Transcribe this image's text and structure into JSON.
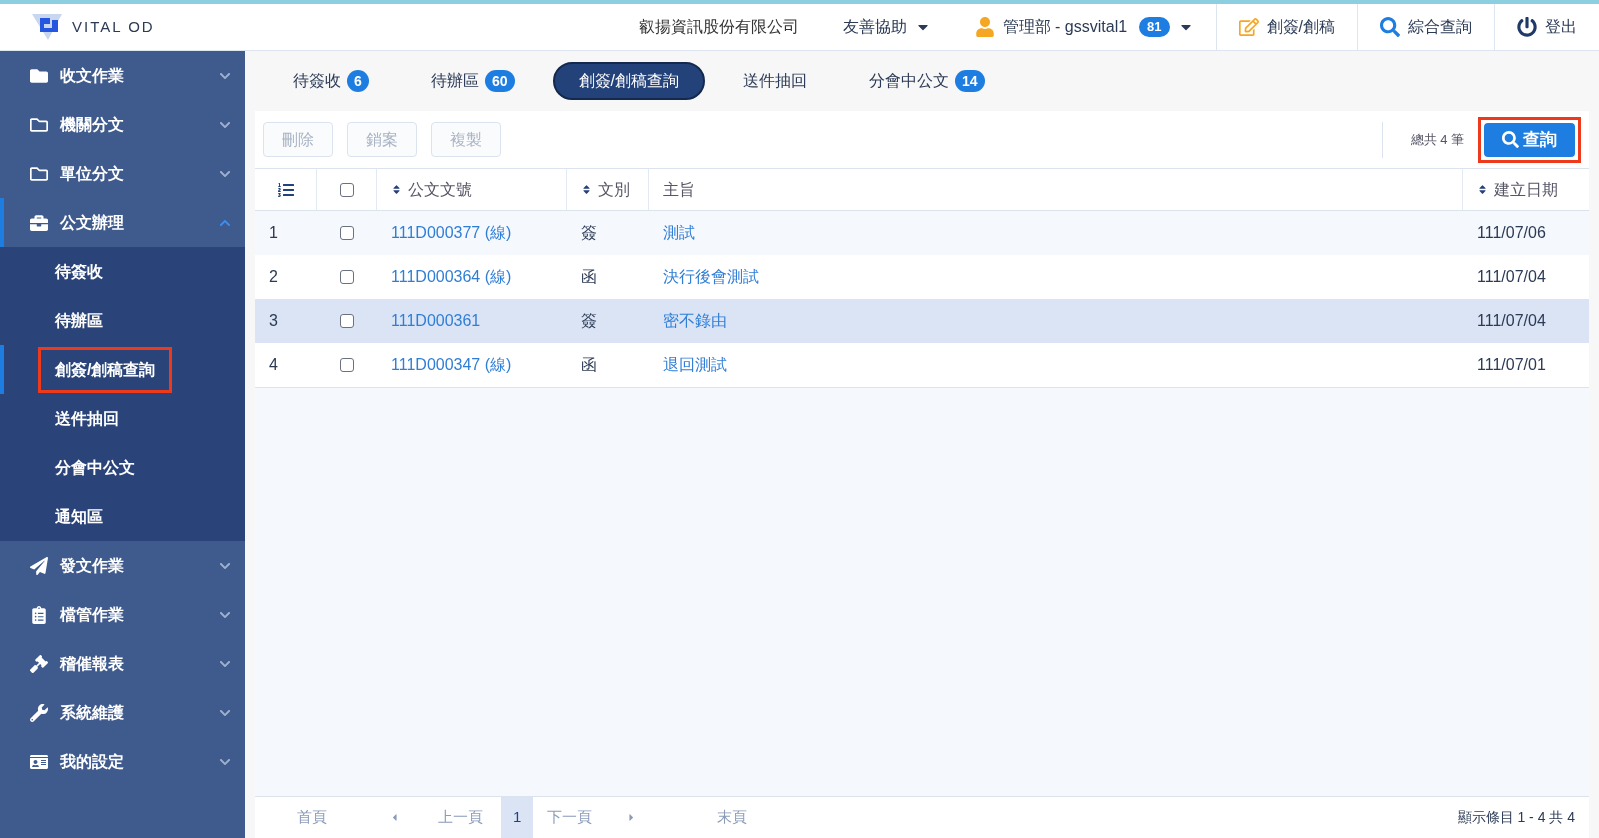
{
  "header": {
    "logo_text": "VITAL OD",
    "company": "叡揚資訊股份有限公司",
    "help": "友善協助",
    "user": "管理部 - gssvital1",
    "user_badge": "81",
    "actions": [
      {
        "label": "創簽/創稿",
        "kind": "edit"
      },
      {
        "label": "綜合查詢",
        "kind": "search"
      },
      {
        "label": "登出",
        "kind": "logout"
      }
    ]
  },
  "sidebar": {
    "items": [
      {
        "label": "收文作業",
        "expanded": false,
        "active": false
      },
      {
        "label": "機關分文",
        "expanded": false,
        "active": false
      },
      {
        "label": "單位分文",
        "expanded": false,
        "active": false
      },
      {
        "label": "公文辦理",
        "expanded": true,
        "active": true,
        "children": [
          {
            "label": "待簽收",
            "selected": false,
            "highlighted": false
          },
          {
            "label": "待辦區",
            "selected": false,
            "highlighted": false
          },
          {
            "label": "創簽/創稿查詢",
            "selected": true,
            "highlighted": true
          },
          {
            "label": "送件抽回",
            "selected": false,
            "highlighted": false
          },
          {
            "label": "分會中公文",
            "selected": false,
            "highlighted": false
          },
          {
            "label": "通知區",
            "selected": false,
            "highlighted": false
          }
        ]
      },
      {
        "label": "發文作業",
        "expanded": false,
        "active": false
      },
      {
        "label": "檔管作業",
        "expanded": false,
        "active": false
      },
      {
        "label": "稽催報表",
        "expanded": false,
        "active": false
      },
      {
        "label": "系統維護",
        "expanded": false,
        "active": false
      },
      {
        "label": "我的設定",
        "expanded": false,
        "active": false
      }
    ]
  },
  "tabs": [
    {
      "label": "待簽收",
      "badge": "6",
      "selected": false
    },
    {
      "label": "待辦區",
      "badge": "60",
      "selected": false
    },
    {
      "label": "創簽/創稿查詢",
      "selected": true
    },
    {
      "label": "送件抽回",
      "selected": false
    },
    {
      "label": "分會中公文",
      "badge": "14",
      "selected": false
    }
  ],
  "toolbar": {
    "buttons": [
      {
        "label": "刪除",
        "disabled": true
      },
      {
        "label": "銷案",
        "disabled": true
      },
      {
        "label": "複製",
        "disabled": true
      }
    ],
    "total": "總共 4 筆",
    "query_button": {
      "label": "查詢",
      "highlighted": true
    }
  },
  "table": {
    "select_all_checked": false,
    "columns": [
      "公文文號",
      "文別",
      "主旨",
      "建立日期"
    ],
    "rows": [
      {
        "index": "1",
        "checked": false,
        "doc_no": "111D000377 (線)",
        "type": "簽",
        "subject": "測試",
        "date": "111/07/06",
        "selected": false
      },
      {
        "index": "2",
        "checked": false,
        "doc_no": "111D000364 (線)",
        "type": "函",
        "subject": "決行後會測試",
        "date": "111/07/04",
        "selected": false
      },
      {
        "index": "3",
        "checked": false,
        "doc_no": "111D000361",
        "type": "簽",
        "subject": "密不錄由",
        "date": "111/07/04",
        "selected": true
      },
      {
        "index": "4",
        "checked": false,
        "doc_no": "111D000347 (線)",
        "type": "函",
        "subject": "退回測試",
        "date": "111/07/01",
        "selected": false
      }
    ]
  },
  "pagination": {
    "first": "首頁",
    "prev": "上一頁",
    "pages": [
      {
        "label": "1",
        "selected": true
      }
    ],
    "next": "下一頁",
    "last": "末頁",
    "summary": "顯示條目 1 - 4 共 4"
  }
}
